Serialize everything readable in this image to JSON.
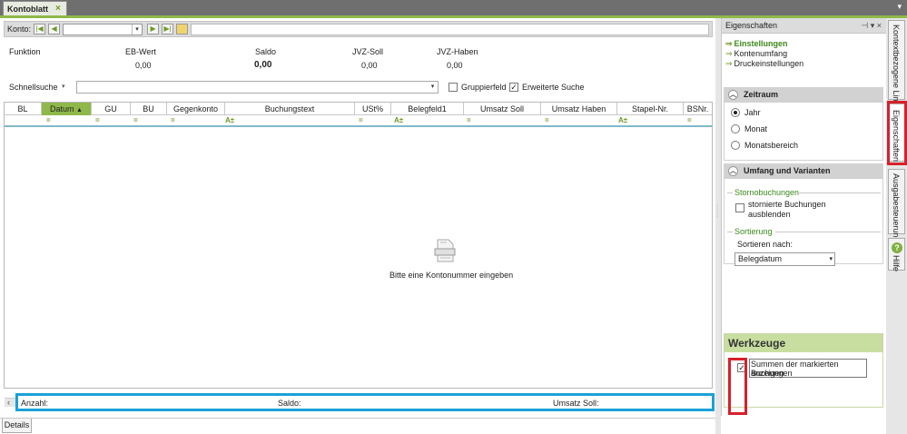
{
  "window": {
    "tab_title": "Kontoblatt",
    "tab_close": "×",
    "menu_arrow": "▾"
  },
  "toolbar": {
    "konto_label": "Konto:",
    "konto_value": "",
    "nav_first": "|◀",
    "nav_prev": "◀",
    "nav_next": "▶",
    "nav_last": "▶|"
  },
  "summary": {
    "funktion_label": "Funktion",
    "eb_wert_label": "EB-Wert",
    "eb_wert_value": "0,00",
    "saldo_label": "Saldo",
    "saldo_value": "0,00",
    "jvz_soll_label": "JVZ-Soll",
    "jvz_soll_value": "0,00",
    "jvz_haben_label": "JVZ-Haben",
    "jvz_haben_value": "0,00"
  },
  "search": {
    "label": "Schnellsuche",
    "value": "",
    "gruppierfeld_label": "Gruppierfeld",
    "gruppierfeld_checked": false,
    "erweiterte_label": "Erweiterte Suche",
    "erweiterte_checked": true
  },
  "grid": {
    "columns": [
      "BL",
      "Datum",
      "GU",
      "BU",
      "Gegenkonto",
      "Buchungstext",
      "USt%",
      "Belegfeld1",
      "Umsatz Soll",
      "Umsatz Haben",
      "Stapel-Nr.",
      "BSNr."
    ],
    "sorted_column": "Datum",
    "empty_message": "Bitte eine Kontonummer eingeben",
    "filter_text_icon": "A±",
    "filter_eq_icon": "="
  },
  "statusbar": {
    "anzahl_label": "Anzahl:",
    "saldo_label": "Saldo:",
    "umsatz_soll_label": "Umsatz Soll:"
  },
  "bottom_tabs": [
    "Details"
  ],
  "properties": {
    "title": "Eigenschaften",
    "pin_icon": "⊣",
    "dropdown_icon": "▾",
    "close_icon": "×",
    "links": [
      "Einstellungen",
      "Kontenumfang",
      "Druckeinstellungen"
    ],
    "zeitraum": {
      "title": "Zeitraum",
      "options": [
        "Jahr",
        "Monat",
        "Monatsbereich"
      ],
      "selected": "Jahr"
    },
    "umfang": {
      "title": "Umfang und Varianten",
      "storno_group": "Stornobuchungen",
      "storno_checkbox_label_1": "stornierte Buchungen",
      "storno_checkbox_label_2": "ausblenden",
      "sortierung_group": "Sortierung",
      "sortieren_label": "Sortieren nach:",
      "sortieren_value": "Belegdatum"
    },
    "werkzeuge": {
      "title": "Werkzeuge",
      "summen_label_1": "Summen der markierten Buchungen",
      "summen_label_2": "anzeigen",
      "summen_checked": true
    }
  },
  "side_tabs": {
    "kontextbezogene": "Kontextbezogene Links",
    "eigenschaften": "Eigenschaften",
    "ausgabesteuerung": "Ausgabesteuerung",
    "hilfe": "Hilfe"
  },
  "colors": {
    "accent_green": "#8fb84a",
    "highlight_red": "#d8202a",
    "highlight_blue": "#1aa1d8"
  }
}
